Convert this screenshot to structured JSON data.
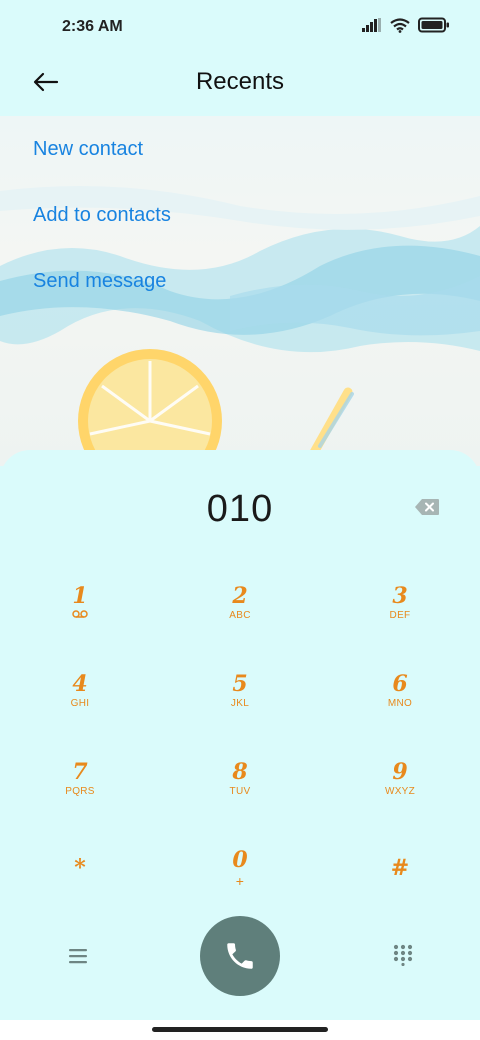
{
  "status_bar": {
    "time": "2:36 AM",
    "icons": [
      "signal-icon",
      "wifi-icon",
      "battery-icon"
    ]
  },
  "header": {
    "title": "Recents",
    "back_icon": "back-arrow-icon"
  },
  "actions": [
    {
      "label": "New contact"
    },
    {
      "label": "Add to contacts"
    },
    {
      "label": "Send message"
    }
  ],
  "dialer": {
    "number": "010",
    "keys": [
      {
        "digit": "1",
        "letters": "voicemail-icon"
      },
      {
        "digit": "2",
        "letters": "ABC"
      },
      {
        "digit": "3",
        "letters": "DEF"
      },
      {
        "digit": "4",
        "letters": "GHI"
      },
      {
        "digit": "5",
        "letters": "JKL"
      },
      {
        "digit": "6",
        "letters": "MNO"
      },
      {
        "digit": "7",
        "letters": "PQRS"
      },
      {
        "digit": "8",
        "letters": "TUV"
      },
      {
        "digit": "9",
        "letters": "WXYZ"
      },
      {
        "digit": "*",
        "letters": ""
      },
      {
        "digit": "0",
        "letters": "+"
      },
      {
        "digit": "#",
        "letters": ""
      }
    ]
  },
  "colors": {
    "background": "#dafbfb",
    "link": "#1883e0",
    "key": "#e8891c",
    "call_button": "#5f7f7b"
  }
}
